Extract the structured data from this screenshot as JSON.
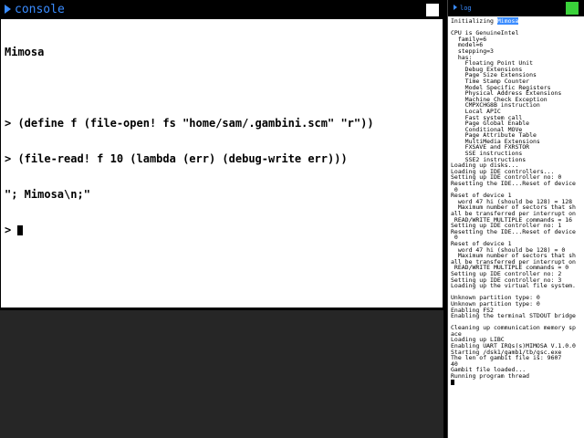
{
  "console": {
    "title": "console",
    "banner": "Mimosa",
    "lines": [
      {
        "prompt": "> ",
        "text": "(define f (file-open! fs \"home/sam/.gambini.scm\" \"r\"))"
      },
      {
        "prompt": "> ",
        "text": "(file-read! f 10 (lambda (err) (debug-write err)))"
      },
      {
        "prompt": "",
        "text": "\"; Mimosa\\n;\""
      },
      {
        "prompt": "> ",
        "text": ""
      }
    ]
  },
  "log": {
    "title": "log",
    "first_line_prefix": "Initializing ",
    "first_line_highlight": "Mimosa",
    "lines": [
      "",
      "CPU is GenuineIntel",
      "  family=6",
      "  model=6",
      "  stepping=3",
      "  has:",
      "    Floating Point Unit",
      "    Debug Extensions",
      "    Page Size Extensions",
      "    Time Stamp Counter",
      "    Model Specific Registers",
      "    Physical Address Extensions",
      "    Machine Check Exception",
      "    CMPXCHG8B instruction",
      "    Local APIC",
      "    Fast system call",
      "    Page Global Enable",
      "    Conditional MOVe",
      "    Page Attribute Table",
      "    MultiMedia Extensions",
      "    FXSAVE and FXRSTOR",
      "    SSE instructions",
      "    SSE2 instructions",
      "Loading up disks...",
      "Loading up IDE controllers...",
      "Setting up IDE controller no: 0",
      "Resetting the IDE...Reset of device",
      " 0",
      "Reset of device 1",
      "  word 47 hi (should be 128) = 128",
      "  Maximum number of sectors that sh",
      "all be transferred per interrupt on",
      " READ/WRITE MULTIPLE commands = 16",
      "Setting up IDE controller no: 1",
      "Resetting the IDE...Reset of device",
      " 0",
      "Reset of device 1",
      "  word 47 hi (should be 128) = 0",
      "  Maximum number of sectors that sh",
      "all be transferred per interrupt on",
      " READ/WRITE MULTIPLE commands = 0",
      "Setting up IDE controller no: 2",
      "Setting up IDE controller no: 3",
      "Loading up the virtual file system.",
      "",
      "Unknown partition type: 0",
      "Unknown partition type: 0",
      "Enabling FS2",
      "Enabling the terminal STDOUT bridge",
      "",
      "Cleaning up communication memory sp",
      "ace",
      "Loading up LIBC",
      "Enabling UART IRQs(s)MIMOSA V.1.0.0",
      "Starting /dsk1/gamb1/tb/gsc.exe",
      "The len of gambit file is: 9607",
      "40",
      "Gambit file loaded...",
      "Running program thread"
    ]
  }
}
